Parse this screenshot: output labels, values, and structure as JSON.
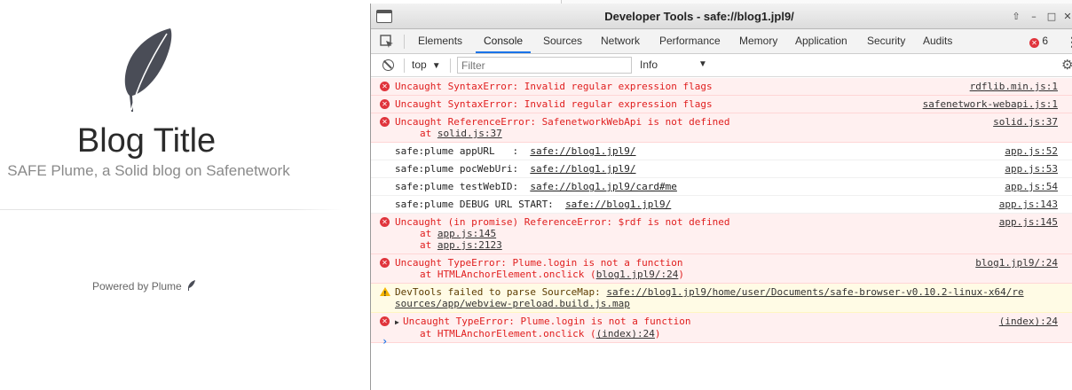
{
  "blog": {
    "title": "Blog Title",
    "subtitle": "SAFE Plume, a Solid blog on Safenetwork",
    "footer": "Powered by Plume"
  },
  "devtools": {
    "window_title": "Developer Tools - safe://blog1.jpl9/",
    "tabs": [
      "Elements",
      "Console",
      "Sources",
      "Network",
      "Performance",
      "Memory",
      "Application",
      "Security",
      "Audits"
    ],
    "active_tab": "Console",
    "error_count": "6",
    "context": "top",
    "filter_placeholder": "Filter",
    "level": "Info"
  },
  "console": {
    "rows": [
      {
        "type": "error",
        "msg": "Uncaught SyntaxError: Invalid regular expression flags",
        "src": "rdflib.min.js:1"
      },
      {
        "type": "error",
        "msg": "Uncaught SyntaxError: Invalid regular expression flags",
        "src": "safenetwork-webapi.js:1"
      },
      {
        "type": "error",
        "msg": "Uncaught ReferenceError: SafenetworkWebApi is not defined",
        "sub1_prefix": "at ",
        "sub1_link": "solid.js:37",
        "src": "solid.js:37"
      },
      {
        "type": "log",
        "msg": "safe:plume appURL   :  ",
        "link": "safe://blog1.jpl9/",
        "src": "app.js:52"
      },
      {
        "type": "log",
        "msg": "safe:plume pocWebUri:  ",
        "link": "safe://blog1.jpl9/",
        "src": "app.js:53"
      },
      {
        "type": "log",
        "msg": "safe:plume testWebID:  ",
        "link": "safe://blog1.jpl9/card#me",
        "src": "app.js:54"
      },
      {
        "type": "log",
        "msg": "safe:plume DEBUG URL START:  ",
        "link": "safe://blog1.jpl9/",
        "src": "app.js:143"
      },
      {
        "type": "error",
        "msg": "Uncaught (in promise) ReferenceError: $rdf is not defined",
        "sub1_prefix": "at ",
        "sub1_link": "app.js:145",
        "sub2_prefix": "at ",
        "sub2_link": "app.js:2123",
        "src": "app.js:145"
      },
      {
        "type": "error",
        "msg": "Uncaught TypeError: Plume.login is not a function",
        "sub1_prefix": "at HTMLAnchorElement.onclick (",
        "sub1_link": "blog1.jpl9/:24",
        "sub1_suffix": ")",
        "src": "blog1.jpl9/:24"
      },
      {
        "type": "warn",
        "msg": "DevTools failed to parse SourceMap: ",
        "link": "safe://blog1.jpl9/home/user/Documents/safe-browser-v0.10.2-linux-x64/re",
        "line2": "sources/app/webview-preload.build.js.map"
      },
      {
        "type": "error",
        "msg": "Uncaught TypeError: Plume.login is not a function",
        "sub1_prefix": "at HTMLAnchorElement.onclick (",
        "sub1_link": "(index):24",
        "sub1_suffix": ")",
        "src": "(index):24",
        "expandable": true
      }
    ],
    "prompt": "›"
  },
  "colors": {
    "error_text": "#e01e1e",
    "error_bg": "#fff0f0",
    "warn_bg": "#fffbe5",
    "accent": "#1a73e8",
    "feather": "#4a4d57"
  }
}
